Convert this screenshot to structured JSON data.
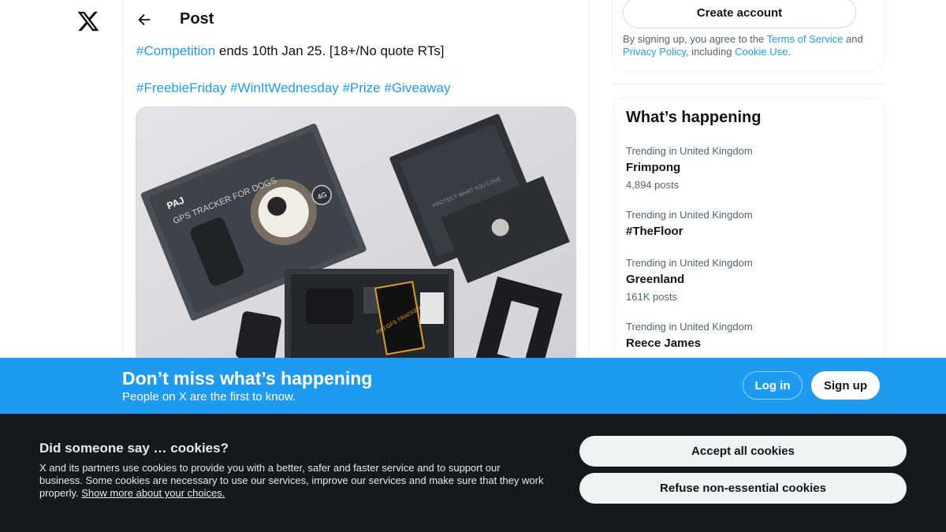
{
  "nav": {
    "logo_icon": "x-logo-icon"
  },
  "post": {
    "title": "Post",
    "line1": {
      "hashtag": "#Competition",
      "text": " ends 10th Jan 25. [18+/No quote RTs]"
    },
    "hashtags": [
      "#FreebieFriday",
      "#WinItWednesday",
      "#Prize",
      "#Giveaway"
    ],
    "media": {
      "box_brand": "PAJ",
      "box_text": "GPS TRACKER FOR DOGS",
      "box_badge": "4G",
      "box_lid_text": "PROTECT WHAT YOU LOVE",
      "sticker_text": "PAJ GPS TRACKER"
    }
  },
  "sidebar": {
    "create_account": "Create account",
    "terms": {
      "prefix": "By signing up, you agree to the ",
      "tos": "Terms of Service",
      "and": " and ",
      "privacy": "Privacy Policy",
      "including": ", including ",
      "cookie": "Cookie Use",
      "end": "."
    },
    "happening_title": "What’s happening",
    "trends": [
      {
        "context": "Trending in United Kingdom",
        "name": "Frimpong",
        "count": "4,894 posts"
      },
      {
        "context": "Trending in United Kingdom",
        "name": "#TheFloor",
        "count": ""
      },
      {
        "context": "Trending in United Kingdom",
        "name": "Greenland",
        "count": "161K posts"
      },
      {
        "context": "Trending in United Kingdom",
        "name": "Reece James",
        "count": ""
      }
    ]
  },
  "banner": {
    "title": "Don’t miss what’s happening",
    "subtitle": "People on X are the first to know.",
    "login": "Log in",
    "signup": "Sign up"
  },
  "cookies": {
    "title": "Did someone say … cookies?",
    "text": "X and its partners use cookies to provide you with a better, safer and faster service and to support our business. Some cookies are necessary to use our services, improve our services and make sure that they work properly. ",
    "link": "Show more about your choices.",
    "accept": "Accept all cookies",
    "refuse": "Refuse non-essential cookies"
  },
  "colors": {
    "accent": "#1d9bf0",
    "cookie_bg": "#15181c",
    "text": "#0f1419",
    "muted": "#536471"
  }
}
